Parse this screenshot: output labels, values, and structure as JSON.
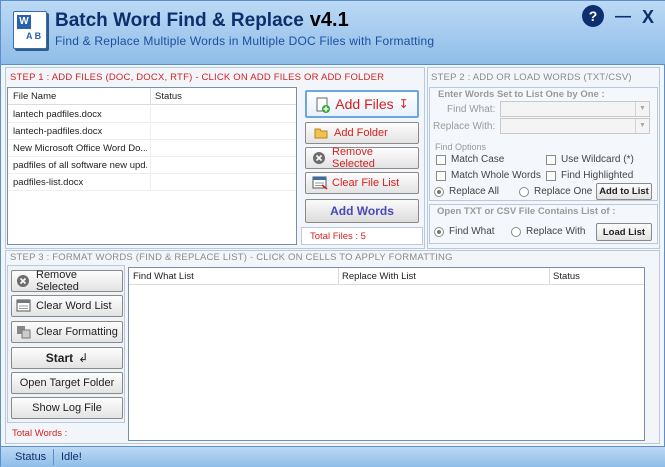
{
  "app": {
    "title": "Batch Word Find & Replace",
    "version": "v4.1",
    "subtitle": "Find & Replace Multiple Words in Multiple DOC Files with Formatting",
    "logo_letter": "W",
    "logo_ab": "A B",
    "help": "?",
    "minimize": "—",
    "close": "X"
  },
  "step1": {
    "title": "STEP 1 : ADD FILES (DOC, DOCX, RTF) - CLICK ON ADD FILES OR ADD FOLDER",
    "columns": [
      "File Name",
      "Status"
    ],
    "files": [
      "lantech padfiles.docx",
      "lantech-padfiles.docx",
      "New Microsoft Office Word Do...",
      "padfiles of all software new upd...",
      "padfiles-list.docx"
    ],
    "buttons": {
      "add_files": "Add Files",
      "add_files_arrow": "↧",
      "add_folder": "Add Folder",
      "remove_selected": "Remove Selected",
      "clear_file_list": "Clear File List",
      "add_words": "Add Words"
    },
    "total_files": "Total Files : 5"
  },
  "step2": {
    "title": "STEP 2 : ADD OR LOAD WORDS (TXT/CSV)",
    "group1_title": "Enter Words Set to List One by One :",
    "find_what_label": "Find What:",
    "replace_with_label": "Replace With:",
    "find_options_label": "Find Options",
    "options": {
      "match_case": "Match Case",
      "use_wildcard": "Use Wildcard (*)",
      "match_whole_words": "Match Whole Words",
      "find_highlighted": "Find Highlighted"
    },
    "replace_all": "Replace All",
    "replace_one": "Replace One",
    "add_to_list": "Add to List",
    "group2_title": "Open TXT or CSV File Contains List of :",
    "find_what_radio": "Find What",
    "replace_with_radio": "Replace With",
    "load_list": "Load List"
  },
  "step3": {
    "title": "STEP 3 : FORMAT WORDS (FIND & REPLACE LIST) - CLICK ON CELLS TO APPLY FORMATTING",
    "buttons": {
      "remove_selected": "Remove Selected",
      "clear_word_list": "Clear Word List",
      "clear_formatting": "Clear Formatting",
      "start": "Start",
      "start_icon": "↲",
      "open_target_folder": "Open Target Folder",
      "show_log_file": "Show Log File"
    },
    "columns": [
      "Find What List",
      "Replace With List",
      "Status"
    ],
    "total_words": "Total Words :"
  },
  "statusbar": {
    "label": "Status",
    "value": "Idle!"
  },
  "colors": {
    "accent_red": "#d62020",
    "title_blue": "#0d2f6e",
    "header_gradient_top": "#bcd9f5",
    "header_gradient_bottom": "#8fbde8"
  }
}
